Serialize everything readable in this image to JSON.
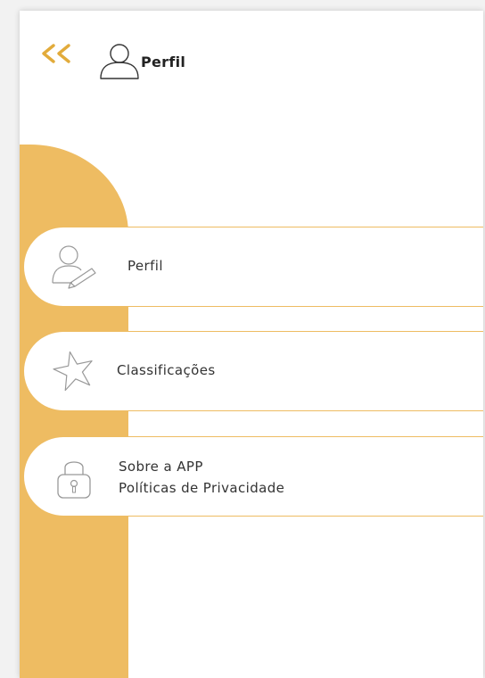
{
  "header": {
    "title": "Perfil",
    "back_icon": "double-chevron-left-icon",
    "avatar_icon": "user-outline-icon"
  },
  "menu": {
    "items": [
      {
        "label": "Perfil",
        "icon": "user-edit-icon"
      },
      {
        "label": "Classificações",
        "icon": "star-outline-icon"
      },
      {
        "label": "Sobre a APP",
        "label2": "Políticas de Privacidade",
        "icon": "lock-icon"
      }
    ]
  },
  "colors": {
    "accent": "#eebc62",
    "background": "#ffffff",
    "text": "#333333"
  }
}
